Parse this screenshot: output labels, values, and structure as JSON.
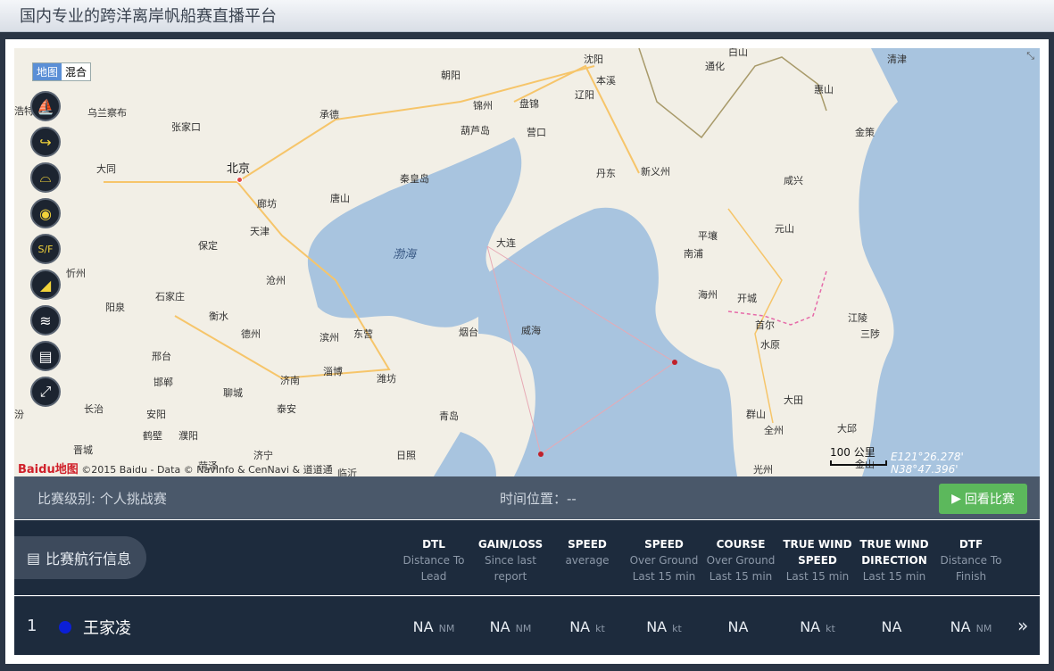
{
  "header": {
    "title": "国内专业的跨洋离岸帆船赛直播平台"
  },
  "map": {
    "type_toggle": [
      "地图",
      "混合"
    ],
    "tools": [
      "sailboat-icon",
      "curve-arrow-icon",
      "helmet-icon",
      "target-icon",
      "start-finish-icon",
      "wind-gauge-icon",
      "wind-icon",
      "ruler-icon",
      "fullscreen-icon"
    ],
    "tool_glyphs": [
      "⛵",
      "↪",
      "⌓",
      "◉",
      "S/F",
      "◢",
      "≋",
      "▤",
      "⤢"
    ],
    "scale_label": "100 公里",
    "coords_e": "E121°26.278'",
    "coords_n": "N38°47.396'",
    "copyright": "©2015 Baidu - Data © NavInfo & CenNavi & 道道通",
    "logo_text": "Baidu地图",
    "places": [
      {
        "name": "北京",
        "big": true
      },
      "天津",
      "廊坊",
      "唐山",
      "承德",
      "张家口",
      "乌兰察布",
      "大同",
      "保定",
      "沧州",
      "石家庄",
      "衡水",
      "德州",
      "滨州",
      "东营",
      "淄博",
      "潍坊",
      "济南",
      "泰安",
      "聊城",
      "邢台",
      "邯郸",
      "安阳",
      "长治",
      "鹤壁",
      "濮阳",
      "晋城",
      "菏泽",
      "济宁",
      "临沂",
      "日照",
      "青岛",
      "烟台",
      "威海",
      "大连",
      "秦皇岛",
      "葫芦岛",
      "锦州",
      "盘锦",
      "营口",
      "朝阳",
      "沈阳",
      "本溪",
      "辽阳",
      "丹东",
      "新义州",
      "通化",
      "白山",
      "惠山",
      "清津",
      "金策",
      "咸兴",
      "元山",
      "平壤",
      "南浦",
      "海州",
      "开城",
      "首尔",
      "水原",
      "江陵",
      "三陟",
      "大田",
      "群山",
      "全州",
      "大邱",
      "光州",
      "金山",
      "忻州",
      "阳泉",
      "浩特",
      "汾"
    ],
    "sea_label": "渤海"
  },
  "race": {
    "level_label": "比赛级别: 个人挑战赛",
    "time_label": "时间位置：--",
    "replay_button": "回看比赛"
  },
  "table": {
    "section_label": "比赛航行信息",
    "columns": [
      {
        "h1": "DTL",
        "h2": "Distance To",
        "h3": "Lead"
      },
      {
        "h1": "GAIN/LOSS",
        "h2": "Since last",
        "h3": "report"
      },
      {
        "h1": "SPEED",
        "h2": "average",
        "h3": ""
      },
      {
        "h1": "SPEED",
        "h2": "Over Ground",
        "h3": "Last 15 min"
      },
      {
        "h1": "COURSE",
        "h2": "Over Ground",
        "h3": "Last 15 min"
      },
      {
        "h1": "TRUE WIND",
        "h2": "SPEED",
        "h3": "Last 15 min"
      },
      {
        "h1": "TRUE WIND",
        "h2": "DIRECTION",
        "h3": "Last 15 min"
      },
      {
        "h1": "DTF",
        "h2": "Distance To",
        "h3": "Finish"
      }
    ],
    "rows": [
      {
        "rank": "1",
        "name": "王家凌",
        "color": "#0b1fd6",
        "cells": [
          {
            "v": "NA",
            "u": "NM"
          },
          {
            "v": "NA",
            "u": "NM"
          },
          {
            "v": "NA",
            "u": "kt"
          },
          {
            "v": "NA",
            "u": "kt"
          },
          {
            "v": "NA",
            "u": ""
          },
          {
            "v": "NA",
            "u": "kt"
          },
          {
            "v": "NA",
            "u": ""
          },
          {
            "v": "NA",
            "u": "NM"
          }
        ]
      }
    ]
  }
}
